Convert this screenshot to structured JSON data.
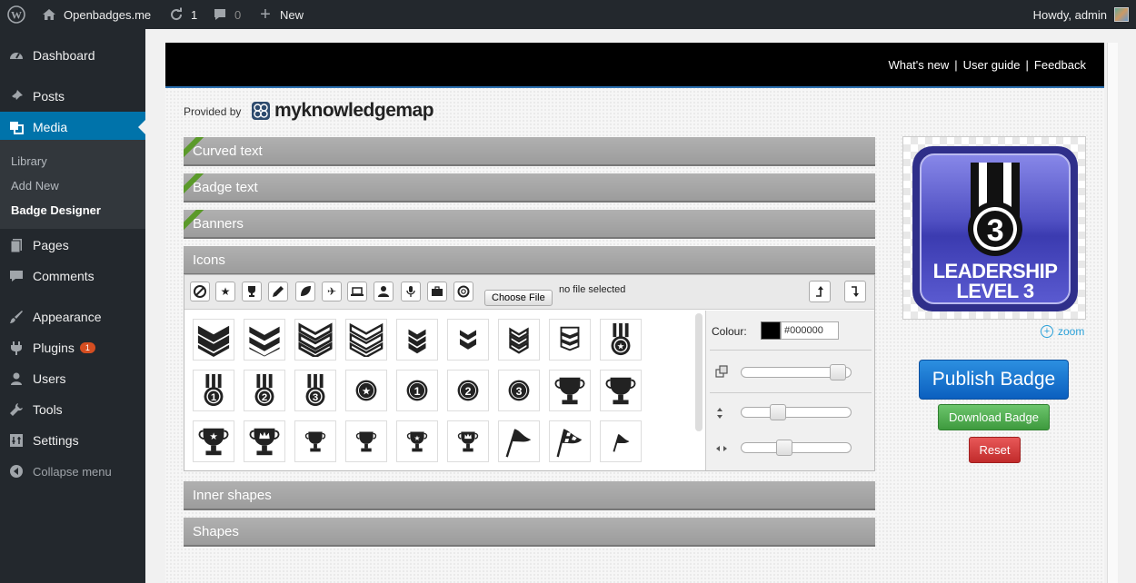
{
  "adminbar": {
    "site_name": "Openbadges.me",
    "updates_count": "1",
    "comments_count": "0",
    "new_label": "New",
    "greeting": "Howdy, admin"
  },
  "sidebar": {
    "items": [
      {
        "label": "Dashboard",
        "icon": "dashboard-icon"
      },
      {
        "label": "Posts",
        "icon": "pin-icon"
      },
      {
        "label": "Media",
        "icon": "media-icon"
      },
      {
        "label": "Pages",
        "icon": "pages-icon"
      },
      {
        "label": "Comments",
        "icon": "comments-icon"
      },
      {
        "label": "Appearance",
        "icon": "brush-icon"
      },
      {
        "label": "Plugins",
        "icon": "plug-icon",
        "badge": "1"
      },
      {
        "label": "Users",
        "icon": "user-icon"
      },
      {
        "label": "Tools",
        "icon": "wrench-icon"
      },
      {
        "label": "Settings",
        "icon": "settings-icon"
      }
    ],
    "submenu": [
      "Library",
      "Add New",
      "Badge Designer"
    ],
    "collapse_label": "Collapse menu"
  },
  "header": {
    "links": [
      "What's new",
      "User guide",
      "Feedback"
    ],
    "separator": "|"
  },
  "branding": {
    "provided_by": "Provided by",
    "logo_text": "myknowledgemap"
  },
  "sections": {
    "curved_text": "Curved text",
    "badge_text": "Badge text",
    "banners": "Banners",
    "icons": "Icons",
    "inner_shapes": "Inner shapes",
    "shapes": "Shapes"
  },
  "icons_panel": {
    "choose_file_label": "Choose File",
    "no_file_text": "no file selected",
    "colour_label": "Colour:",
    "colour_value": "#000000",
    "sliders": {
      "size": 0.95,
      "vertical": 0.3,
      "horizontal": 0.37
    }
  },
  "preview": {
    "badge_number": "3",
    "badge_line1": "LEADERSHIP",
    "badge_line2": "LEVEL 3",
    "zoom_label": "zoom"
  },
  "actions": {
    "publish": "Publish Badge",
    "download": "Download Badge",
    "reset": "Reset"
  },
  "colors": {
    "accent": "#0073aa",
    "publish": "#1170d4",
    "download": "#55b055",
    "reset": "#d63b3b"
  }
}
